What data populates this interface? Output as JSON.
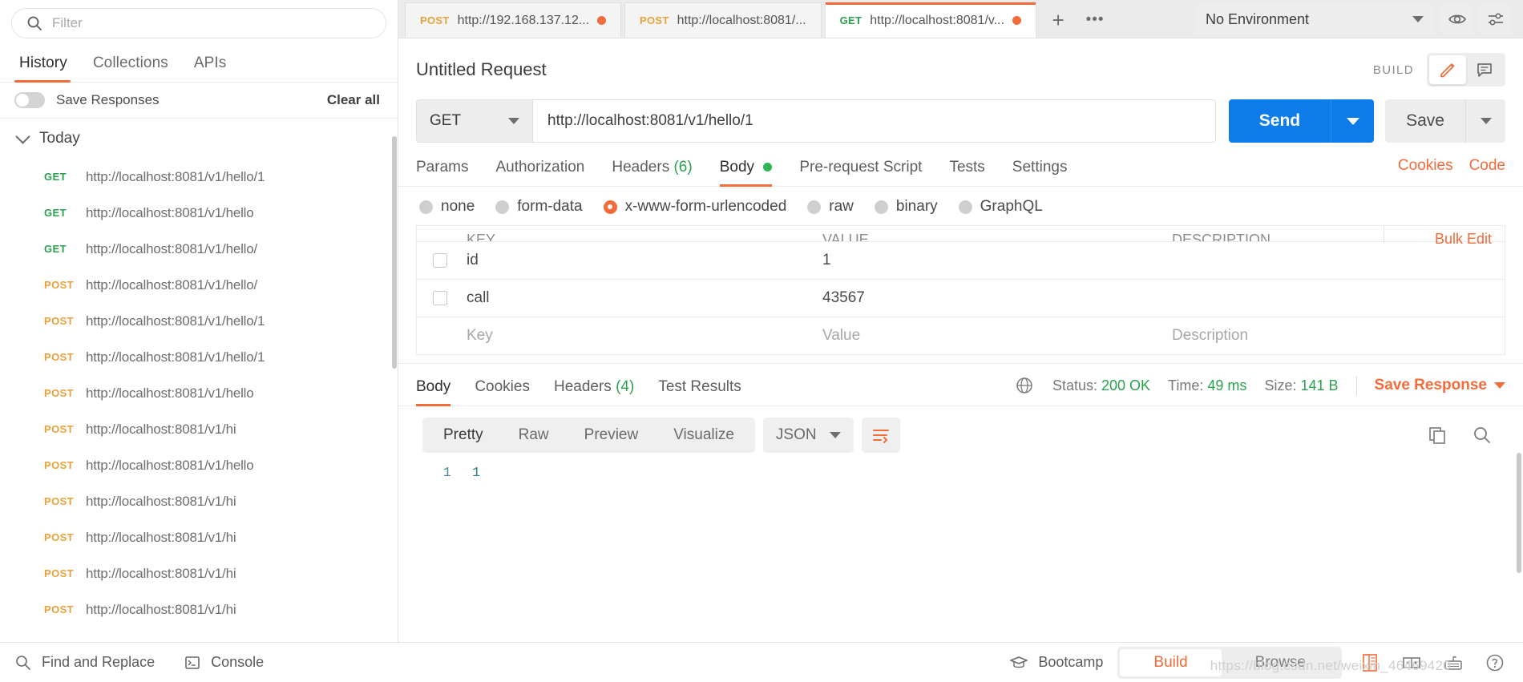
{
  "sidebar": {
    "filter_placeholder": "Filter",
    "tabs": [
      {
        "label": "History",
        "active": true
      },
      {
        "label": "Collections",
        "active": false
      },
      {
        "label": "APIs",
        "active": false
      }
    ],
    "save_responses_label": "Save Responses",
    "clear_all_label": "Clear all",
    "group_label": "Today",
    "history": [
      {
        "method": "GET",
        "url": "http://localhost:8081/v1/hello/1"
      },
      {
        "method": "GET",
        "url": "http://localhost:8081/v1/hello"
      },
      {
        "method": "GET",
        "url": "http://localhost:8081/v1/hello/"
      },
      {
        "method": "POST",
        "url": "http://localhost:8081/v1/hello/"
      },
      {
        "method": "POST",
        "url": "http://localhost:8081/v1/hello/1"
      },
      {
        "method": "POST",
        "url": "http://localhost:8081/v1/hello/1"
      },
      {
        "method": "POST",
        "url": "http://localhost:8081/v1/hello"
      },
      {
        "method": "POST",
        "url": "http://localhost:8081/v1/hi"
      },
      {
        "method": "POST",
        "url": "http://localhost:8081/v1/hello"
      },
      {
        "method": "POST",
        "url": "http://localhost:8081/v1/hi"
      },
      {
        "method": "POST",
        "url": "http://localhost:8081/v1/hi"
      },
      {
        "method": "POST",
        "url": "http://localhost:8081/v1/hi"
      },
      {
        "method": "POST",
        "url": "http://localhost:8081/v1/hi"
      }
    ]
  },
  "tabbar": {
    "tabs": [
      {
        "method": "POST",
        "url": "http://192.168.137.12...",
        "unsaved": true,
        "active": false
      },
      {
        "method": "POST",
        "url": "http://localhost:8081/...",
        "unsaved": false,
        "active": false
      },
      {
        "method": "GET",
        "url": "http://localhost:8081/v...",
        "unsaved": true,
        "active": true
      }
    ],
    "new_tab_label": "+",
    "more_label": "•••",
    "environment": "No Environment"
  },
  "request": {
    "title": "Untitled Request",
    "build_label": "BUILD",
    "method": "GET",
    "url": "http://localhost:8081/v1/hello/1",
    "send_label": "Send",
    "save_label": "Save",
    "tabs": [
      {
        "label": "Params",
        "suffix": "",
        "active": false,
        "dot": false
      },
      {
        "label": "Authorization",
        "suffix": "",
        "active": false,
        "dot": false
      },
      {
        "label": "Headers",
        "suffix": "(6)",
        "active": false,
        "dot": false
      },
      {
        "label": "Body",
        "suffix": "",
        "active": true,
        "dot": true
      },
      {
        "label": "Pre-request Script",
        "suffix": "",
        "active": false,
        "dot": false
      },
      {
        "label": "Tests",
        "suffix": "",
        "active": false,
        "dot": false
      },
      {
        "label": "Settings",
        "suffix": "",
        "active": false,
        "dot": false
      }
    ],
    "cookies_label": "Cookies",
    "code_label": "Code",
    "body_types": [
      {
        "label": "none",
        "selected": false
      },
      {
        "label": "form-data",
        "selected": false
      },
      {
        "label": "x-www-form-urlencoded",
        "selected": true
      },
      {
        "label": "raw",
        "selected": false
      },
      {
        "label": "binary",
        "selected": false
      },
      {
        "label": "GraphQL",
        "selected": false
      }
    ],
    "table": {
      "headers": [
        "KEY",
        "VALUE",
        "DESCRIPTION"
      ],
      "bulk_edit_label": "Bulk Edit",
      "rows": [
        {
          "checked": false,
          "key": "id",
          "value": "1",
          "description": "",
          "placeholder": false
        },
        {
          "checked": false,
          "key": "call",
          "value": "43567",
          "description": "",
          "placeholder": false
        },
        {
          "checked": false,
          "key": "Key",
          "value": "Value",
          "description": "Description",
          "placeholder": true
        }
      ]
    }
  },
  "response": {
    "tabs": [
      {
        "label": "Body",
        "suffix": "",
        "active": true
      },
      {
        "label": "Cookies",
        "suffix": "",
        "active": false
      },
      {
        "label": "Headers",
        "suffix": "(4)",
        "active": false
      },
      {
        "label": "Test Results",
        "suffix": "",
        "active": false
      }
    ],
    "status_label": "Status:",
    "status_value": "200 OK",
    "time_label": "Time:",
    "time_value": "49 ms",
    "size_label": "Size:",
    "size_value": "141 B",
    "save_response_label": "Save Response",
    "view_modes": [
      {
        "label": "Pretty",
        "active": true
      },
      {
        "label": "Raw",
        "active": false
      },
      {
        "label": "Preview",
        "active": false
      },
      {
        "label": "Visualize",
        "active": false
      }
    ],
    "format": "JSON",
    "body_lines": [
      {
        "number": "1",
        "text": "1"
      }
    ]
  },
  "footer": {
    "find_replace_label": "Find and Replace",
    "console_label": "Console",
    "bootcamp_label": "Bootcamp",
    "modes": [
      {
        "label": "Build",
        "active": true
      },
      {
        "label": "Browse",
        "active": false
      }
    ]
  },
  "watermark": "https://blog.csdn.net/weixin_46469420",
  "colors": {
    "accent_orange": "#f26b3a",
    "send_blue": "#0d7ce8",
    "get_green": "#2ba14e",
    "post_yellow": "#e9a13b"
  }
}
